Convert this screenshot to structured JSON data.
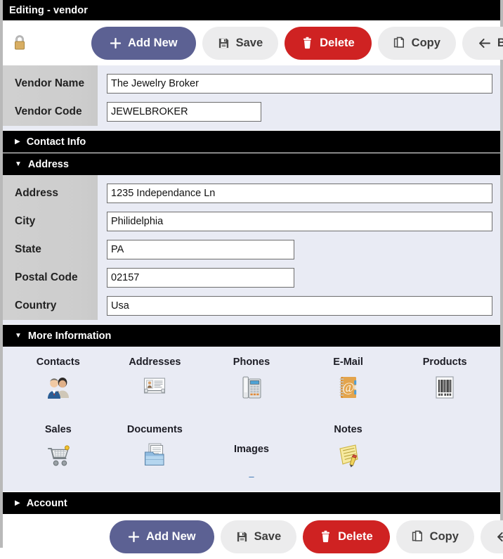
{
  "window": {
    "title": "Editing - vendor"
  },
  "toolbar": {
    "lock_icon": "padlock-icon",
    "buttons": [
      {
        "label": "Add New",
        "icon": "plus-icon",
        "style": "primary"
      },
      {
        "label": "Save",
        "icon": "floppy-disk-icon",
        "style": "neutral"
      },
      {
        "label": "Delete",
        "icon": "trash-icon",
        "style": "danger"
      },
      {
        "label": "Copy",
        "icon": "copy-pages-icon",
        "style": "neutral"
      },
      {
        "label": "Back",
        "icon": "arrow-left-icon",
        "style": "neutral"
      }
    ]
  },
  "identity_fields": [
    {
      "label": "Vendor Name",
      "value": "The Jewelry Broker",
      "width": "full"
    },
    {
      "label": "Vendor Code",
      "value": "JEWELBROKER",
      "width": "code"
    }
  ],
  "sections": {
    "contact_info": {
      "title": "Contact Info",
      "expanded": false,
      "arrow": "triangle-right"
    },
    "address": {
      "title": "Address",
      "expanded": true,
      "arrow": "triangle-down"
    },
    "more_info": {
      "title": "More Information",
      "expanded": true,
      "arrow": "triangle-down"
    },
    "account": {
      "title": "Account",
      "expanded": false,
      "arrow": "triangle-right"
    }
  },
  "address_fields": [
    {
      "label": "Address",
      "value": "1235 Independance Ln",
      "width": "full"
    },
    {
      "label": "City",
      "value": "Philidelphia",
      "width": "full"
    },
    {
      "label": "State",
      "value": "PA",
      "width": "short"
    },
    {
      "label": "Postal Code",
      "value": "02157",
      "width": "short"
    },
    {
      "label": "Country",
      "value": "Usa",
      "width": "full"
    }
  ],
  "more_information": {
    "row1": [
      {
        "label": "Contacts",
        "icon": "two-people-icon"
      },
      {
        "label": "Addresses",
        "icon": "id-card-icon"
      },
      {
        "label": "Phones",
        "icon": "desk-phone-icon"
      },
      {
        "label": "E-Mail",
        "icon": "address-book-at-icon"
      },
      {
        "label": "Products",
        "icon": "barcode-icon"
      }
    ],
    "row2": [
      {
        "label": "Sales",
        "icon": "shopping-cart-icon",
        "broken": false
      },
      {
        "label": "Documents",
        "icon": "folder-documents-icon",
        "broken": false
      },
      {
        "label": "Images",
        "icon": "broken-image-icon",
        "broken": true
      },
      {
        "label": "Notes",
        "icon": "notepad-pencil-icon",
        "broken": false
      },
      {
        "label": "",
        "icon": "",
        "broken": false
      }
    ]
  },
  "colors": {
    "primary": "#5c6193",
    "danger": "#cf2222",
    "neutral": "#ececed",
    "panel": "#e9ebf4",
    "label_column": "#cdcdcd",
    "section_bar": "#000000"
  }
}
